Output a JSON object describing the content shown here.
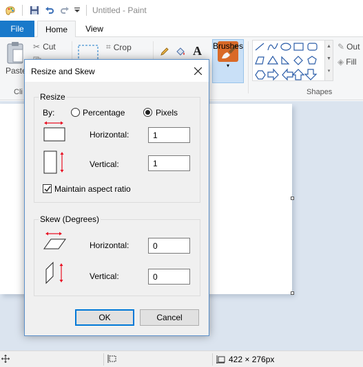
{
  "titlebar": {
    "title": "Untitled - Paint"
  },
  "tabs": {
    "file": "File",
    "home": "Home",
    "view": "View"
  },
  "ribbon": {
    "cut": "Cut",
    "crop": "Crop",
    "paste": "Paste",
    "clipboard_group": "Cli",
    "brushes": "Brushes",
    "shapes_group": "Shapes",
    "outline": "Out",
    "fill": "Fill",
    "text_tool": "A"
  },
  "dialog": {
    "title": "Resize and Skew",
    "resize_legend": "Resize",
    "by_label": "By:",
    "percentage_label": "Percentage",
    "pixels_label": "Pixels",
    "selected_unit": "Pixels",
    "resize_horizontal_label": "Horizontal:",
    "resize_horizontal_value": "1",
    "resize_vertical_label": "Vertical:",
    "resize_vertical_value": "1",
    "maintain_aspect_label": "Maintain aspect ratio",
    "maintain_aspect_checked": true,
    "skew_legend": "Skew (Degrees)",
    "skew_horizontal_label": "Horizontal:",
    "skew_horizontal_value": "0",
    "skew_vertical_label": "Vertical:",
    "skew_vertical_value": "0",
    "ok_label": "OK",
    "cancel_label": "Cancel"
  },
  "statusbar": {
    "canvas_size": "422 × 276px"
  },
  "colors": {
    "accent": "#1979ca",
    "red_arrow": "#e81123",
    "selected_tool": "#c9e0f7"
  }
}
